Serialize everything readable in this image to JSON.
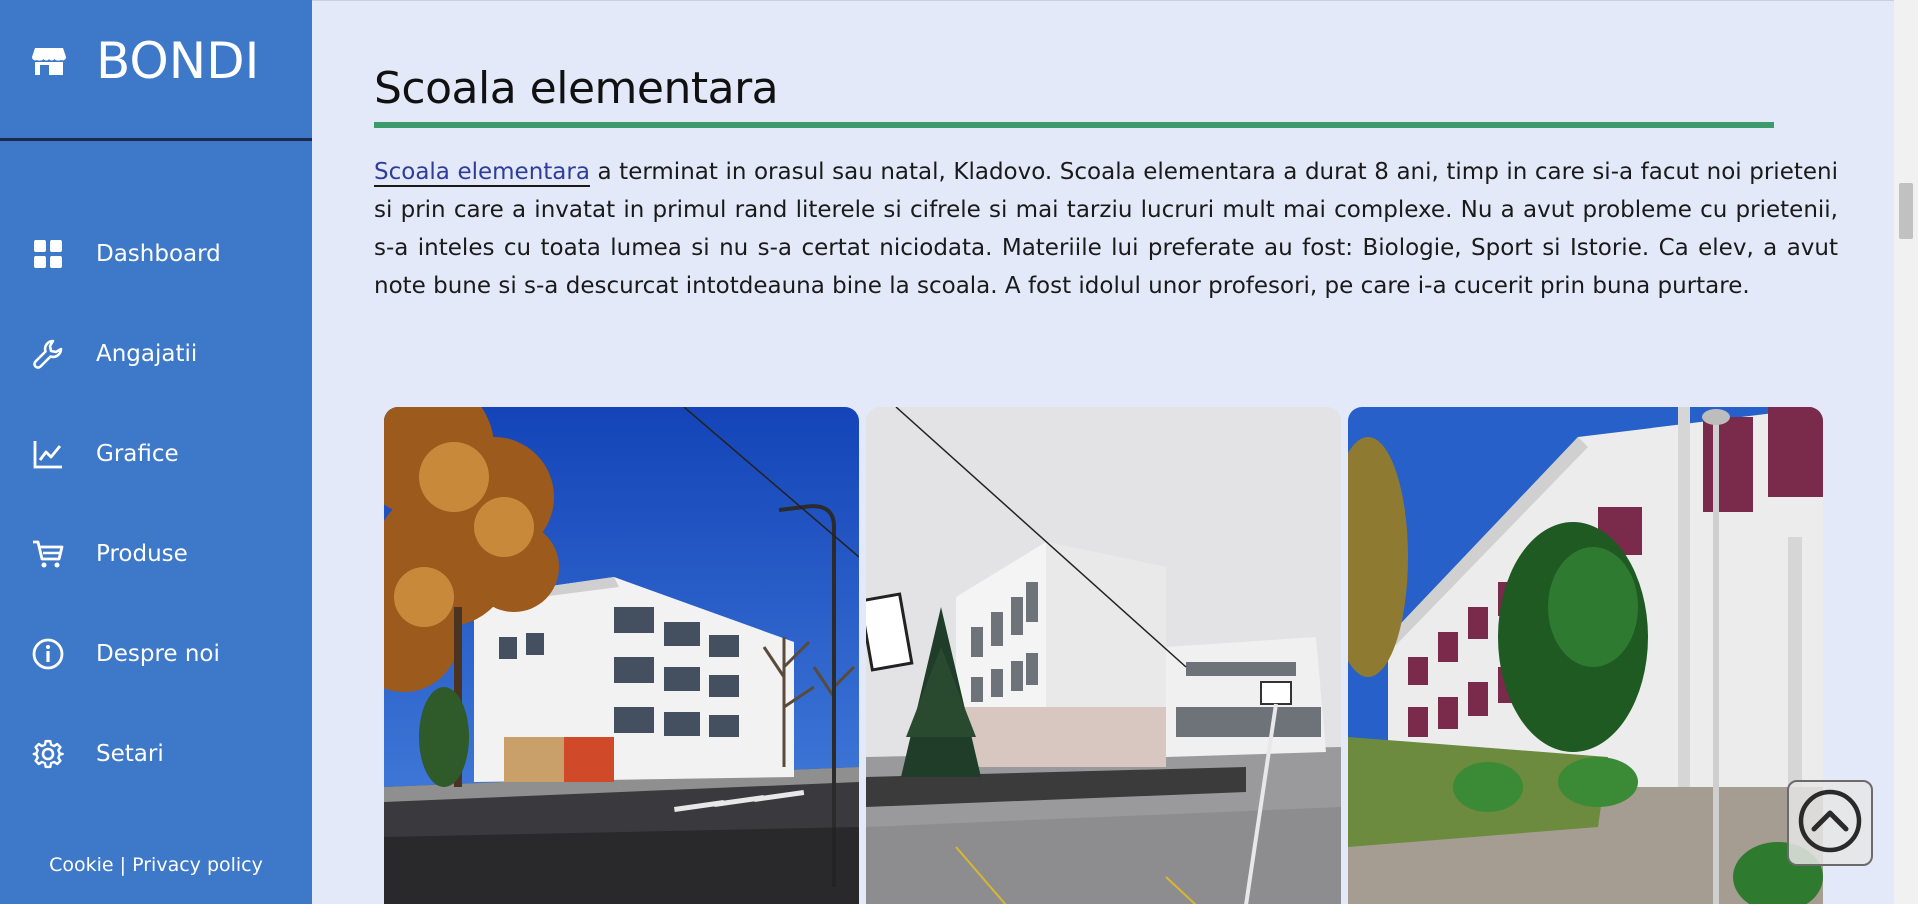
{
  "brand": {
    "name": "BONDI",
    "icon": "store-icon"
  },
  "nav": {
    "items": [
      {
        "label": "Dashboard",
        "icon": "dashboard-grid-icon"
      },
      {
        "label": "Angajatii",
        "icon": "wrench-icon"
      },
      {
        "label": "Grafice",
        "icon": "line-chart-icon"
      },
      {
        "label": "Produse",
        "icon": "shopping-cart-icon"
      },
      {
        "label": "Despre noi",
        "icon": "info-circle-icon"
      },
      {
        "label": "Setari",
        "icon": "gear-icon"
      }
    ]
  },
  "footer": {
    "cookie": "Cookie",
    "separator": " | ",
    "privacy": "Privacy policy"
  },
  "section": {
    "title": "Scoala elementara",
    "link_text": "Scoala elementara",
    "body": " a terminat in orasul sau natal, Kladovo. Scoala elementara a durat 8 ani, timp in care si-a facut noi prieteni si prin care a invatat in primul rand literele si cifrele si mai tarziu lucruri mult mai complexe. Nu a avut probleme cu prietenii, s-a inteles cu toata lumea si nu s-a certat niciodata. Materiile lui preferate au fost: Biologie, Sport si Istorie. Ca elev, a avut note bune si s-a descurcat intotdeauna bine la scoala. A fost idolul unor profesori, pe care i-a cucerit prin buna purtare."
  },
  "colors": {
    "sidebar": "#3e78c9",
    "page_background": "#e3e9f8",
    "title_rule": "#3c9b6a",
    "link": "#2e3d9a"
  },
  "back_to_top": {
    "icon": "chevron-up-circle-icon"
  }
}
